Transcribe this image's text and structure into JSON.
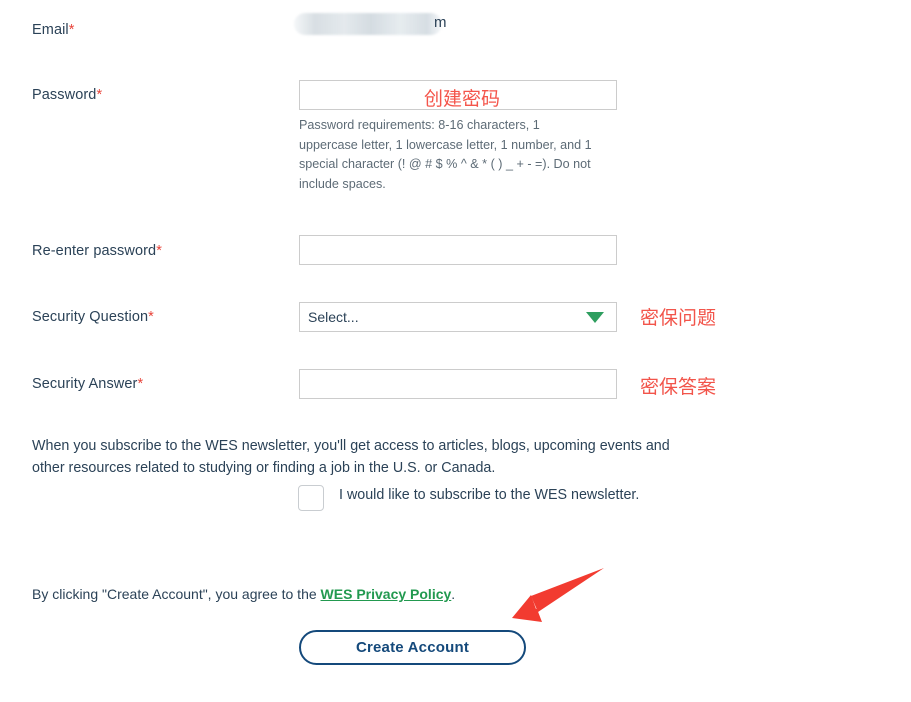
{
  "form": {
    "fields": [
      {
        "id": "email",
        "label": "Email",
        "required_mark": "*",
        "value_redacted_tail": "m",
        "value": ""
      },
      {
        "id": "password",
        "label": "Password",
        "required_mark": "*",
        "value": "",
        "annotation": "创建密码",
        "hint": "Password requirements: 8-16 characters, 1 uppercase letter, 1 lowercase letter, 1 number, and 1 special character (! @ # $ % ^ & * ( ) _ + - =). Do not include spaces."
      },
      {
        "id": "reenter-password",
        "label": "Re-enter password",
        "required_mark": "*",
        "value": ""
      },
      {
        "id": "security-question",
        "label": "Security Question",
        "required_mark": "*",
        "selected": "Select...",
        "annotation": "密保问题"
      },
      {
        "id": "security-answer",
        "label": "Security Answer",
        "required_mark": "*",
        "value": "",
        "annotation": "密保答案"
      }
    ]
  },
  "newsletter": {
    "description": "When you subscribe to the WES newsletter, you'll get access to articles, blogs, upcoming events and other resources related to studying or finding a job in the U.S. or Canada.",
    "checkbox_label": "I would like to subscribe to the WES newsletter.",
    "checked": false
  },
  "legal": {
    "prefix": "By clicking \"Create Account\", you agree to the ",
    "link_text": "WES Privacy Policy",
    "suffix": "."
  },
  "submit": {
    "label": "Create Account"
  },
  "colors": {
    "label_text": "#2b4257",
    "required_red": "#e8443a",
    "annotation_red": "#f2544a",
    "arrow_red": "#f23b30",
    "link_green": "#22994f",
    "caret_green": "#2e9e5f",
    "button_border": "#14497b",
    "field_border": "#cccccc",
    "hint_text": "#5d6b76"
  }
}
